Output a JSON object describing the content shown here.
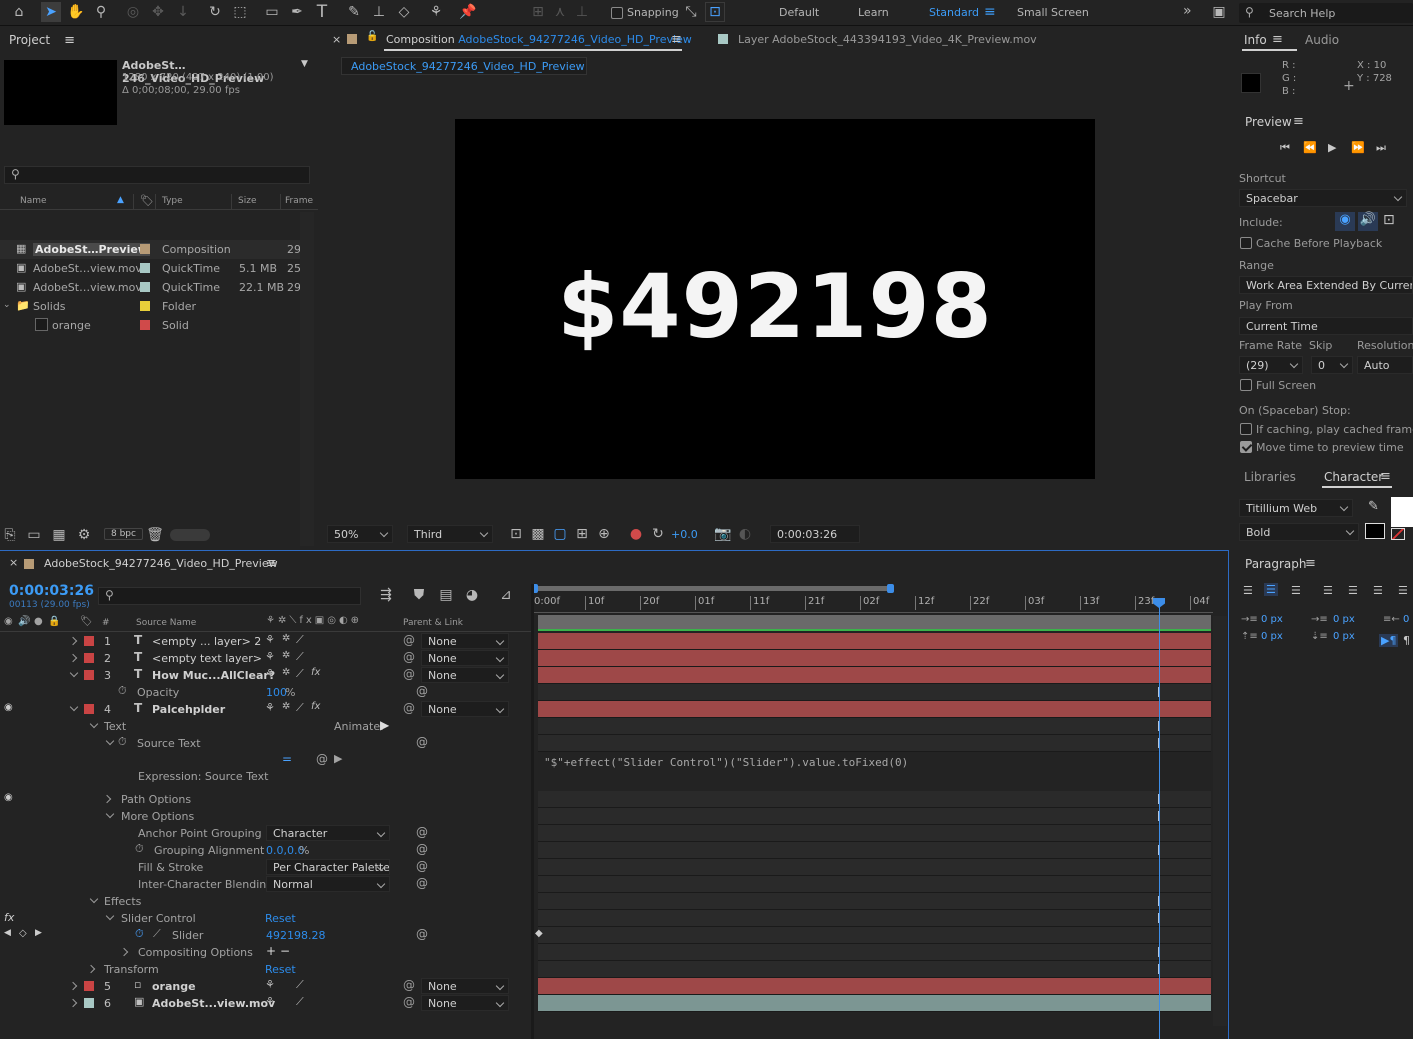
{
  "toolbar": {
    "snapping_label": "Snapping",
    "workspaces": [
      "Default",
      "Learn",
      "Standard",
      "Small Screen"
    ],
    "active_workspace": "Standard",
    "search_placeholder": "Search Help"
  },
  "project": {
    "title": "Project",
    "item_name": "AdobeSt…246_Video_HD_Preview",
    "item_dims": "1280 x 720  (427 x 240) (1.00)",
    "item_duration": "Δ 0;00;08;00, 29.00 fps",
    "columns": {
      "name": "Name",
      "type": "Type",
      "size": "Size",
      "frame": "Frame"
    },
    "rows": [
      {
        "name": "AdobeSt…Preview",
        "type": "Composition",
        "size": "",
        "frame": "29",
        "color": "#b79b76"
      },
      {
        "name": "AdobeSt…view.mov",
        "type": "QuickTime",
        "size": "5.1 MB",
        "frame": "25",
        "color": "#a8c8c4"
      },
      {
        "name": "AdobeSt…view.mov",
        "type": "QuickTime",
        "size": "22.1 MB",
        "frame": "29",
        "color": "#a8c8c4"
      },
      {
        "name": "Solids",
        "type": "Folder",
        "size": "",
        "frame": "",
        "color": "#e7cf3a"
      },
      {
        "name": "orange",
        "type": "Solid",
        "size": "",
        "frame": "",
        "color": "#d04a4a"
      }
    ],
    "bpc": "8 bpc"
  },
  "composition": {
    "tab_prefix": "Composition",
    "tab_name": "AdobeStock_94277246_Video_HD_Preview",
    "layer_tab": "Layer AdobeStock_443394193_Video_4K_Preview.mov",
    "breadcrumb": "AdobeStock_94277246_Video_HD_Preview",
    "viewer_text": "$492198",
    "zoom": "50%",
    "resolution": "Third",
    "exposure": "+0.0",
    "timecode": "0:00:03:26"
  },
  "info": {
    "tab_info": "Info",
    "tab_audio": "Audio",
    "r": "R :",
    "g": "G :",
    "b": "B :",
    "x": "X : 10",
    "y": "Y : 728"
  },
  "preview": {
    "title": "Preview",
    "shortcut_label": "Shortcut",
    "shortcut_value": "Spacebar",
    "include_label": "Include:",
    "cache_label": "Cache Before Playback",
    "range_label": "Range",
    "range_value": "Work Area Extended By Current ...",
    "play_from_label": "Play From",
    "play_from_value": "Current Time",
    "frame_rate_label": "Frame Rate",
    "skip_label": "Skip",
    "resolution_label": "Resolution",
    "frame_rate_value": "(29)",
    "skip_value": "0",
    "resolution_value": "Auto",
    "full_screen_label": "Full Screen",
    "stop_label": "On (Spacebar) Stop:",
    "if_caching_label": "If caching, play cached frames",
    "move_time_label": "Move time to preview time"
  },
  "character": {
    "tab_libraries": "Libraries",
    "tab_character": "Character",
    "font": "Titillium Web",
    "style": "Bold"
  },
  "paragraph": {
    "title": "Paragraph",
    "values": [
      "0 px",
      "0 px",
      "0",
      "0 px",
      "0 px"
    ]
  },
  "timeline": {
    "title": "AdobeStock_94277246_Video_HD_Preview",
    "timecode": "0:00:03:26",
    "frame_info": "00113 (29.00 fps)",
    "col_source": "Source Name",
    "col_parent": "Parent & Link",
    "ruler": [
      "0:00f",
      "10f",
      "20f",
      "01f",
      "11f",
      "21f",
      "02f",
      "12f",
      "22f",
      "03f",
      "13f",
      "23f",
      "04f"
    ],
    "layers": [
      {
        "num": "1",
        "name": "<empty ... layer> 2",
        "parent": "None"
      },
      {
        "num": "2",
        "name": "<empty text layer>",
        "parent": "None"
      },
      {
        "num": "3",
        "name": "How Muc...AllClear?",
        "parent": "None"
      },
      {
        "num": "4",
        "name": "Palcehplder",
        "parent": "None"
      },
      {
        "num": "5",
        "name": "orange",
        "parent": "None"
      },
      {
        "num": "6",
        "name": "AdobeSt...view.mov",
        "parent": "None"
      }
    ],
    "opacity_label": "Opacity",
    "opacity_value": "100",
    "opacity_unit": "%",
    "text_label": "Text",
    "animate_label": "Animate:",
    "source_text_label": "Source Text",
    "expression_label": "Expression: Source Text",
    "expression": "\"$\"+effect(\"Slider Control\")(\"Slider\").value.toFixed(0)",
    "path_options": "Path Options",
    "more_options": "More Options",
    "anchor_grouping_label": "Anchor Point Grouping",
    "anchor_grouping_value": "Character",
    "grouping_alignment_label": "Grouping Alignment",
    "grouping_alignment_value": "0.0,0.0",
    "grouping_alignment_unit": "%",
    "fill_stroke_label": "Fill & Stroke",
    "fill_stroke_value": "Per Character Palette",
    "inter_char_label": "Inter-Character Blending",
    "inter_char_value": "Normal",
    "effects_label": "Effects",
    "slider_control_label": "Slider Control",
    "reset": "Reset",
    "slider_label": "Slider",
    "slider_value": "492198.28",
    "compositing_label": "Compositing Options",
    "transform_label": "Transform"
  }
}
